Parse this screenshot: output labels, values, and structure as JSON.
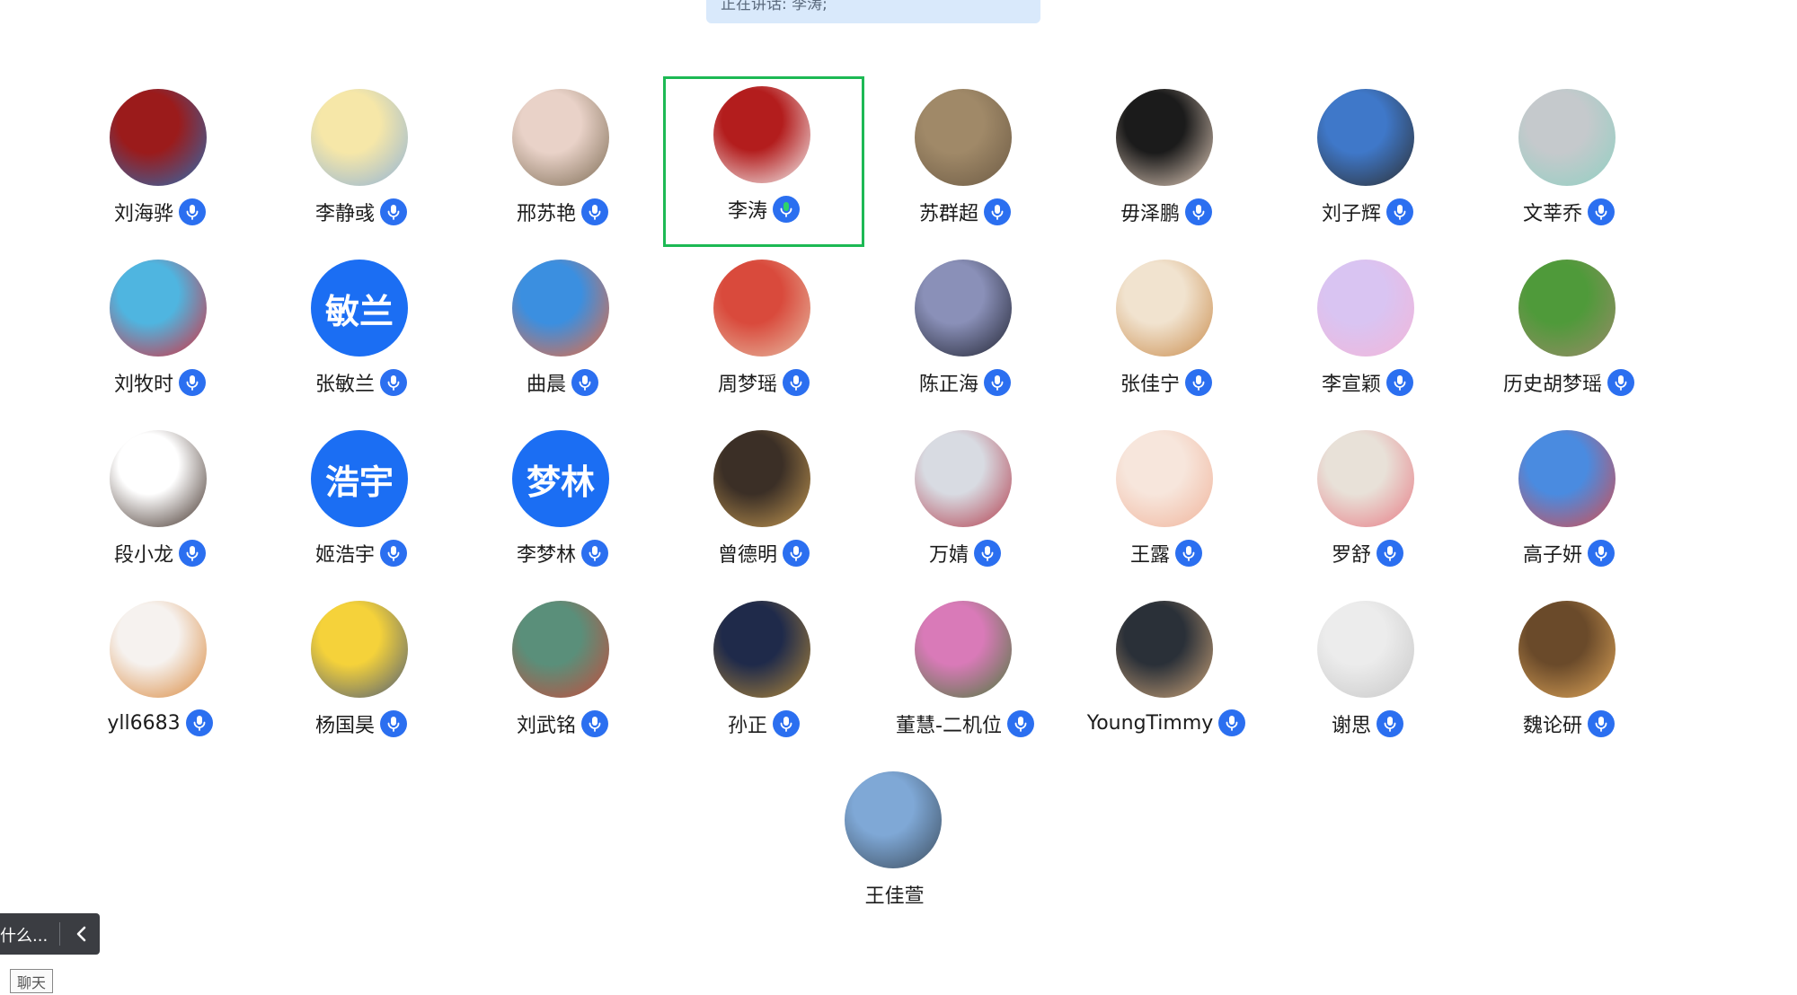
{
  "banner": {
    "text": "正在讲话: 李涛;"
  },
  "participants": [
    {
      "name": "刘海骅",
      "avatar": "peking-university-seal",
      "colors": [
        "#9b1b1b",
        "#2a6fb5"
      ],
      "mic": "mic-icon",
      "active": false
    },
    {
      "name": "李静彧",
      "avatar": "cartoon-girl",
      "colors": [
        "#f6e7a8",
        "#8fb3d9"
      ],
      "mic": "mic-icon",
      "active": false
    },
    {
      "name": "邢苏艳",
      "avatar": "cherry-blossom-couple",
      "colors": [
        "#e9d2c8",
        "#7b6a52"
      ],
      "mic": "mic-icon",
      "active": false
    },
    {
      "name": "李涛",
      "avatar": "pku-badge",
      "colors": [
        "#b31d1d",
        "#f5f5f5"
      ],
      "mic": "mic-speaking-icon",
      "active": true
    },
    {
      "name": "苏群超",
      "avatar": "calligraphy",
      "colors": [
        "#a08968",
        "#6c5a44"
      ],
      "mic": "mic-icon",
      "active": false
    },
    {
      "name": "毋泽鹏",
      "avatar": "man-glasses",
      "colors": [
        "#1b1b1b",
        "#e8d2c0"
      ],
      "mic": "mic-icon",
      "active": false
    },
    {
      "name": "刘子辉",
      "avatar": "man-blue-sky",
      "colors": [
        "#3f78c9",
        "#2d2d2d"
      ],
      "mic": "mic-icon",
      "active": false
    },
    {
      "name": "文莘乔",
      "avatar": "toy-figure",
      "colors": [
        "#c5c9cc",
        "#8fd0c2"
      ],
      "mic": "mic-icon",
      "active": false
    },
    {
      "name": "刘牧时",
      "avatar": "blue-illustration",
      "colors": [
        "#4fb5e0",
        "#d92b3a"
      ],
      "mic": "mic-icon",
      "active": false
    },
    {
      "name": "张敏兰",
      "avatar": "text",
      "avatar_text": "敏兰",
      "colors": [
        "#1b6ef3",
        "#1b6ef3"
      ],
      "mic": "mic-icon",
      "active": false
    },
    {
      "name": "曲晨",
      "avatar": "goldfish-cartoon",
      "colors": [
        "#3b8fe0",
        "#f06a3a"
      ],
      "mic": "mic-icon",
      "active": false
    },
    {
      "name": "周梦瑶",
      "avatar": "kiki-cartoon",
      "colors": [
        "#d94a3c",
        "#e7bfa6"
      ],
      "mic": "mic-icon",
      "active": false
    },
    {
      "name": "陈正海",
      "avatar": "silhouette-sunset",
      "colors": [
        "#8a90b8",
        "#1f2230"
      ],
      "mic": "mic-icon",
      "active": false
    },
    {
      "name": "张佳宁",
      "avatar": "shiba-dog",
      "colors": [
        "#f1e3cf",
        "#c98b4b"
      ],
      "mic": "mic-icon",
      "active": false
    },
    {
      "name": "李宣颖",
      "avatar": "bunny-purple",
      "colors": [
        "#d9c4f2",
        "#f3b5d8"
      ],
      "mic": "mic-icon",
      "active": false
    },
    {
      "name": "历史胡梦瑶",
      "avatar": "cat-leaves",
      "colors": [
        "#4f9a3a",
        "#9c8a6a"
      ],
      "mic": "mic-icon",
      "active": false
    },
    {
      "name": "段小龙",
      "avatar": "cartoon-boy",
      "colors": [
        "#ffffff",
        "#3b2a22"
      ],
      "mic": "mic-icon",
      "active": false
    },
    {
      "name": "姬浩宇",
      "avatar": "text",
      "avatar_text": "浩宇",
      "colors": [
        "#1b6ef3",
        "#1b6ef3"
      ],
      "mic": "mic-icon",
      "active": false
    },
    {
      "name": "李梦林",
      "avatar": "text",
      "avatar_text": "梦林",
      "colors": [
        "#1b6ef3",
        "#1b6ef3"
      ],
      "mic": "mic-icon",
      "active": false
    },
    {
      "name": "曾德明",
      "avatar": "field-sunset",
      "colors": [
        "#3b2f26",
        "#c69a52"
      ],
      "mic": "mic-icon",
      "active": false
    },
    {
      "name": "万婧",
      "avatar": "girl-door",
      "colors": [
        "#d8dbe2",
        "#b23a4a"
      ],
      "mic": "mic-icon",
      "active": false
    },
    {
      "name": "王露",
      "avatar": "cartoon-bear",
      "colors": [
        "#f7e6dc",
        "#f0b39a"
      ],
      "mic": "mic-icon",
      "active": false
    },
    {
      "name": "罗舒",
      "avatar": "puppy",
      "colors": [
        "#e8e1d8",
        "#e77a84"
      ],
      "mic": "mic-icon",
      "active": false
    },
    {
      "name": "高子妍",
      "avatar": "cartoon-girl-cheer",
      "colors": [
        "#4a8be0",
        "#d94b4b"
      ],
      "mic": "mic-icon",
      "active": false
    },
    {
      "name": "yll6683",
      "avatar": "basketball-girl",
      "colors": [
        "#f6f2ef",
        "#d9873b"
      ],
      "mic": "mic-icon",
      "active": false
    },
    {
      "name": "杨国昊",
      "avatar": "minion",
      "colors": [
        "#f5d23a",
        "#4a5a7a"
      ],
      "mic": "mic-icon",
      "active": false
    },
    {
      "name": "刘武铭",
      "avatar": "abstract-painting",
      "colors": [
        "#5a8f7a",
        "#c84a3a"
      ],
      "mic": "mic-icon",
      "active": false
    },
    {
      "name": "孙正",
      "avatar": "milky-way-field",
      "colors": [
        "#1f2a4a",
        "#b48a3a"
      ],
      "mic": "mic-icon",
      "active": false
    },
    {
      "name": "董慧-二机位",
      "avatar": "pink-flowers",
      "colors": [
        "#d97ab8",
        "#4a7a3a"
      ],
      "mic": "mic-icon",
      "active": false
    },
    {
      "name": "YoungTimmy",
      "avatar": "man-restaurant",
      "colors": [
        "#2a3038",
        "#cfa67a"
      ],
      "mic": "mic-icon",
      "active": false
    },
    {
      "name": "谢思",
      "avatar": "sketch-white",
      "colors": [
        "#ececec",
        "#c7c7c7"
      ],
      "mic": "mic-icon",
      "active": false
    },
    {
      "name": "魏论研",
      "avatar": "girl-sunlight",
      "colors": [
        "#6a4a2a",
        "#e2a85a"
      ],
      "mic": "mic-icon",
      "active": false
    },
    {
      "name": "王佳萱",
      "avatar": "girl-lake",
      "colors": [
        "#7fa8d6",
        "#3a4a5a"
      ],
      "mic": "",
      "active": false
    }
  ],
  "bottom_bar": {
    "text": "什么...",
    "collapse_icon": "chevron-left-icon"
  },
  "chat_tag": "聊天",
  "accent": "#2b6ff0",
  "active_border": "#1db954"
}
